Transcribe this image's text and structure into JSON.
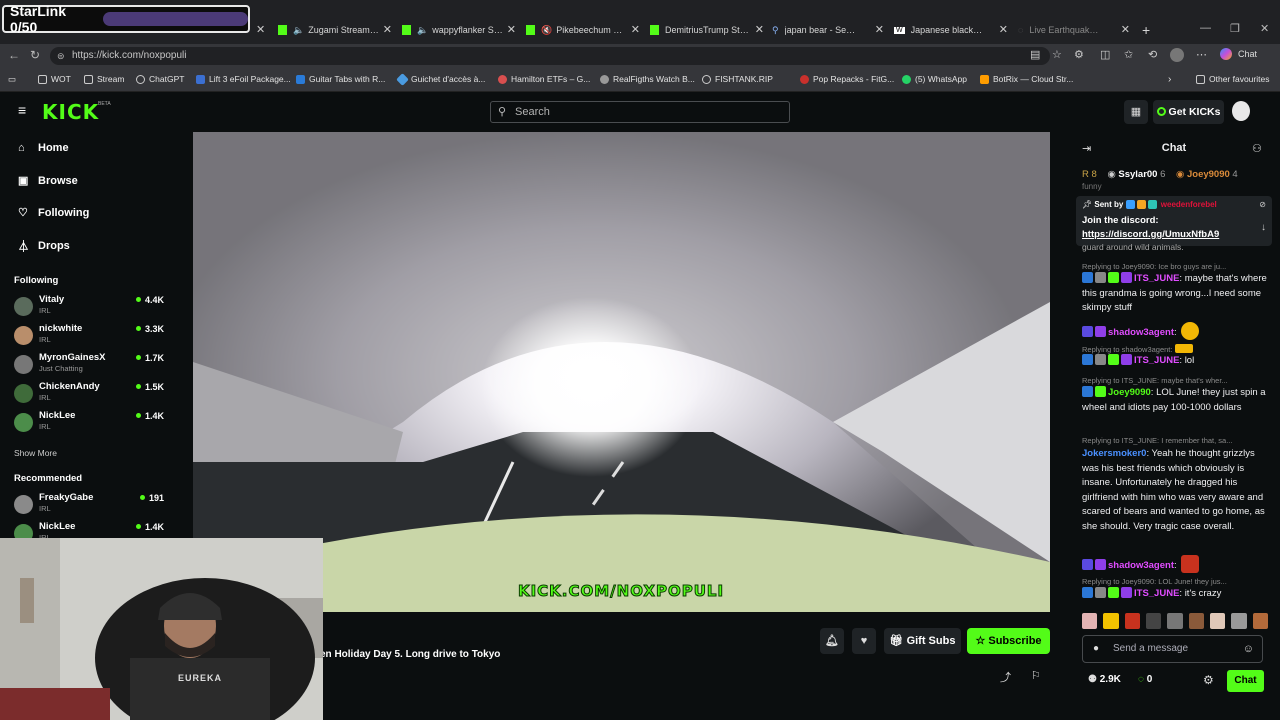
{
  "browser": {
    "starlink_label": "StarLink 0/50",
    "tabs": [
      {
        "label": "Zugami Stream - W"
      },
      {
        "label": "wappyflanker Strea"
      },
      {
        "label": "Pikebeechum Strea"
      },
      {
        "label": "DemitriusTrump Stream"
      },
      {
        "label": "japan bear - Search"
      },
      {
        "label": "Japanese black bear - W"
      },
      {
        "label": "Live Earthquake Tracke"
      }
    ],
    "url": "https://kick.com/noxpopuli",
    "chat_btn": "Chat",
    "bookmarks": [
      "WOT",
      "Stream",
      "ChatGPT",
      "Lift 3 eFoil Package...",
      "Guitar Tabs with R...",
      "Guichet d'accès à...",
      "Hamilton ETFs – G...",
      "RealFigths Watch B...",
      "FISHTANK.RIP",
      "Pop Repacks - FitG...",
      "(5) WhatsApp",
      "BotRix — Cloud Str..."
    ],
    "other_favourites": "Other favourites"
  },
  "site": {
    "logo": "KICK",
    "beta": "BETA",
    "search_placeholder": "Search",
    "get_kicks": "Get KICKs",
    "nav": [
      "Home",
      "Browse",
      "Following",
      "Drops"
    ],
    "following_title": "Following",
    "following": [
      {
        "name": "Vitaly",
        "cat": "IRL",
        "viewers": "4.4K"
      },
      {
        "name": "nickwhite",
        "cat": "IRL",
        "viewers": "3.3K"
      },
      {
        "name": "MyronGainesX",
        "cat": "Just Chatting",
        "viewers": "1.7K"
      },
      {
        "name": "ChickenAndy",
        "cat": "IRL",
        "viewers": "1.5K"
      },
      {
        "name": "NickLee",
        "cat": "IRL",
        "viewers": "1.4K"
      }
    ],
    "show_more": "Show More",
    "recommended_title": "Recommended",
    "recommended": [
      {
        "name": "FreakyGabe",
        "cat": "IRL",
        "viewers": "191"
      },
      {
        "name": "NickLee",
        "cat": "IRL",
        "viewers": "1.4K"
      }
    ]
  },
  "stream": {
    "watermark": "KICK.COM/NOXPOPULI",
    "title": "en Holiday Day 5. Long drive to Tokyo",
    "gift_subs": "Gift Subs",
    "subscribe": "Subscribe",
    "webcam_shirt": "EUREKA"
  },
  "chat": {
    "title": "Chat",
    "leaderboard": [
      {
        "name": "Ssylar00",
        "count": "6"
      },
      {
        "name": "Joey9090",
        "count": "4"
      }
    ],
    "lb_prefix": "R 8",
    "pinned_sent_by": "Sent by",
    "pinned_sender": "weedenforebel",
    "pinned_text": "Join the discord:",
    "pinned_link": "https://discord.gg/UmuxNfbA9",
    "cut_top": "funny",
    "cut_under_pin": "guard around wild animals.",
    "messages": [
      {
        "reply": "Replying to Joey9090: Ice bro guys are ju...",
        "user": "ITS_JUNE",
        "text": "maybe that's where this grandma is going wrong...I need some skimpy stuff"
      },
      {
        "user": "shadow3agent",
        "text": ""
      },
      {
        "reply": "Replying to shadow3agent:",
        "user": "ITS_JUNE",
        "text": "lol"
      },
      {
        "reply": "Replying to ITS_JUNE: maybe that's wher...",
        "user": "Joey9090",
        "text": "LOL June! they just spin a wheel and idiots pay 100-1000 dollars"
      },
      {
        "reply": "Replying to ITS_JUNE: I remember that, sa...",
        "user": "Jokersmoker0",
        "text": "Yeah he thought grizzlys was his best friends which obviously is insane. Unfortunately he dragged his girlfriend with him who was very aware and scared of bears and wanted to go home, as she should. Very tragic case overall."
      },
      {
        "user": "shadow3agent",
        "text": ""
      },
      {
        "reply": "Replying to Joey9090: LOL June! they jus...",
        "user": "ITS_JUNE",
        "text": "it's crazy"
      }
    ],
    "send_placeholder": "Send a message",
    "viewers": "2.9K",
    "points": "0",
    "chat_button": "Chat"
  }
}
